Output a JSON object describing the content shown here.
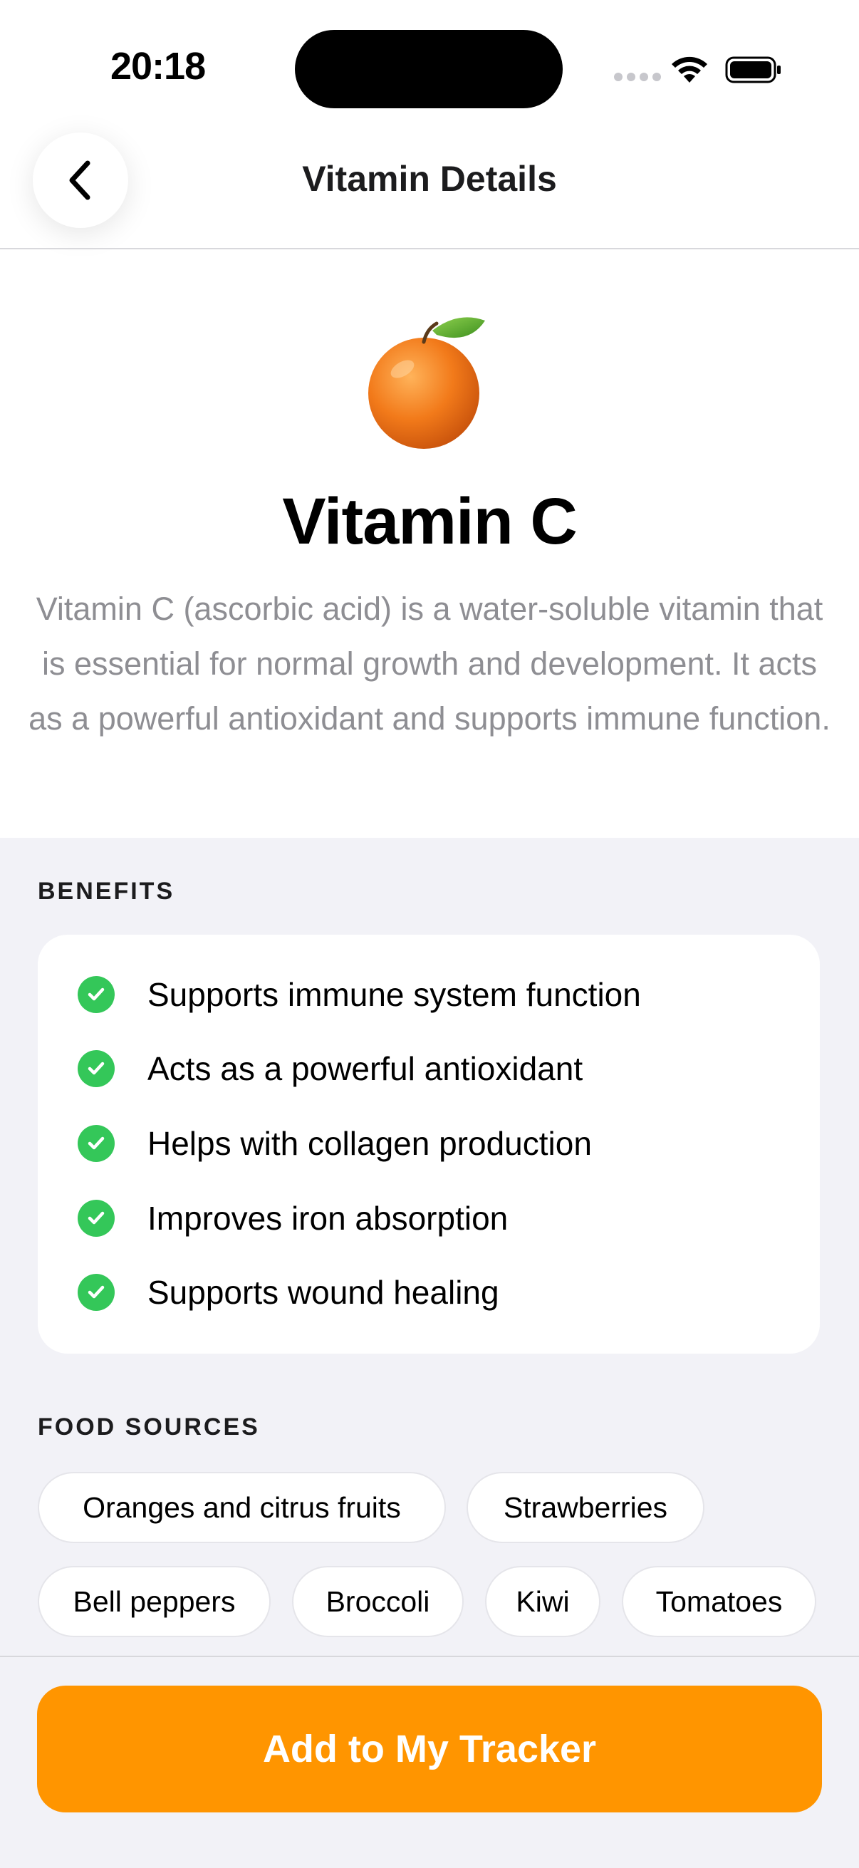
{
  "status_bar": {
    "time": "20:18"
  },
  "nav": {
    "title": "Vitamin Details",
    "back_icon": "chevron-left-icon"
  },
  "hero": {
    "emoji_icon": "orange-emoji-icon",
    "title": "Vitamin C",
    "description": "Vitamin C (ascorbic acid) is a water-soluble vitamin that is essential for normal growth and development. It acts as a powerful antioxidant and supports immune function."
  },
  "benefits": {
    "label": "BENEFITS",
    "check_color": "#34c759",
    "items": [
      "Supports immune system function",
      "Acts as a powerful antioxidant",
      "Helps with collagen production",
      "Improves iron absorption",
      "Supports wound healing"
    ]
  },
  "food_sources": {
    "label": "FOOD SOURCES",
    "items": [
      "Oranges and citrus fruits",
      "Strawberries",
      "Bell peppers",
      "Broccoli",
      "Kiwi",
      "Tomatoes"
    ]
  },
  "cta": {
    "label": "Add to My Tracker",
    "color": "#ff9500"
  }
}
